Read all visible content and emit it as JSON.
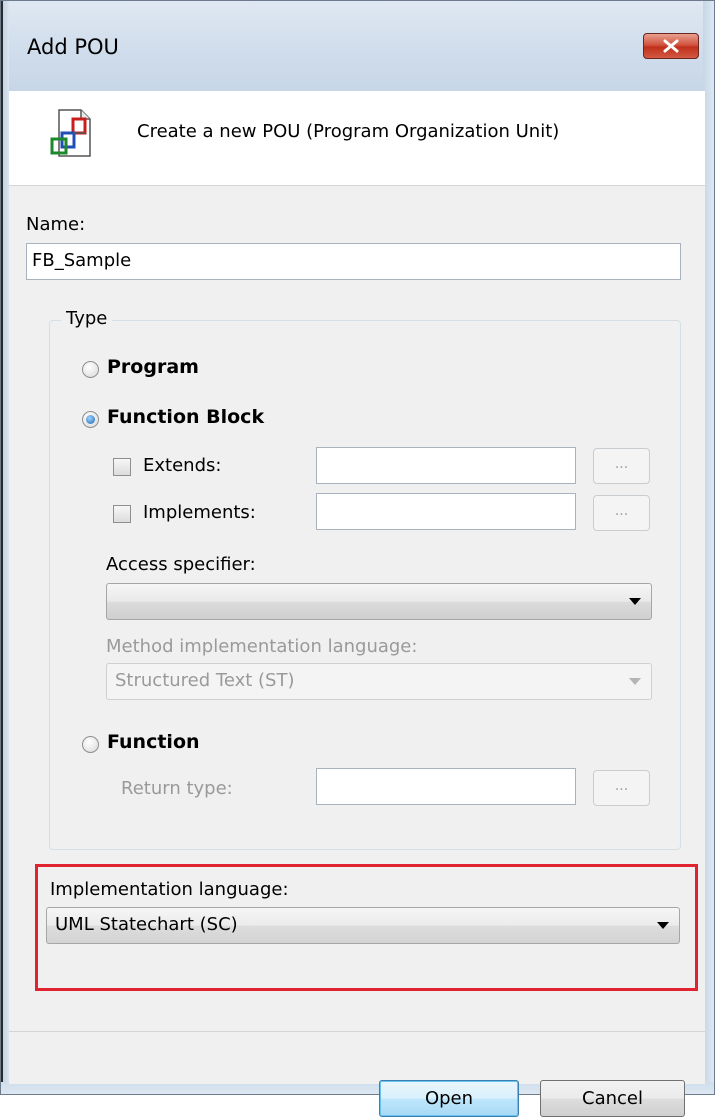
{
  "window": {
    "title": "Add POU"
  },
  "header": {
    "icon": "pou-document-icon",
    "text": "Create a new POU (Program Organization Unit)"
  },
  "name_field": {
    "label": "Name:",
    "value": "FB_Sample"
  },
  "type_group": {
    "legend": "Type",
    "program": {
      "label": "Program",
      "checked": false
    },
    "function_block": {
      "label": "Function Block",
      "checked": true,
      "extends": {
        "label": "Extends:",
        "checked": false,
        "value": "",
        "button": "..."
      },
      "implements": {
        "label": "Implements:",
        "checked": false,
        "value": "",
        "button": "..."
      },
      "access_specifier": {
        "label": "Access specifier:",
        "value": ""
      },
      "method_language": {
        "label": "Method implementation language:",
        "value": "Structured Text (ST)"
      }
    },
    "function": {
      "label": "Function",
      "checked": false,
      "return_type": {
        "label": "Return type:",
        "value": "",
        "button": "..."
      }
    }
  },
  "implementation_language": {
    "label": "Implementation language:",
    "value": "UML Statechart (SC)"
  },
  "buttons": {
    "open": "Open",
    "cancel": "Cancel"
  },
  "colors": {
    "highlight": "#e0232e",
    "close_button": "#c0301c"
  }
}
